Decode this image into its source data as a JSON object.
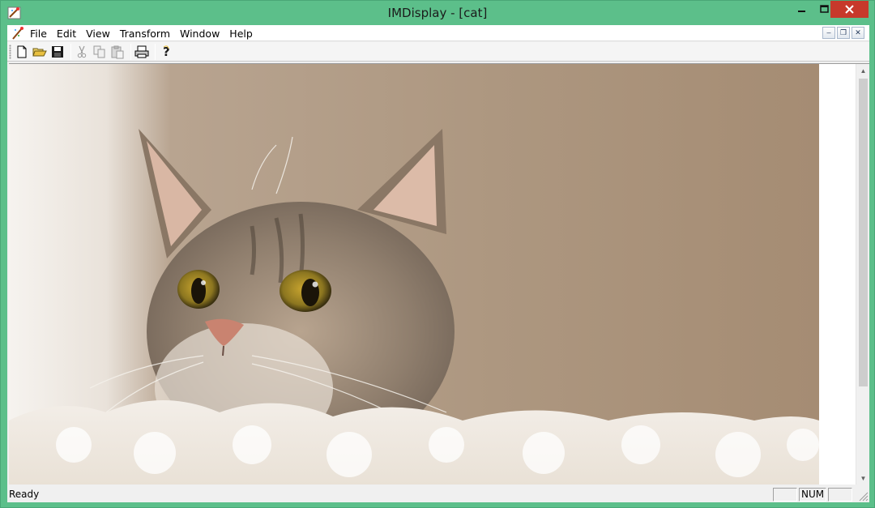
{
  "window": {
    "title": "IMDisplay - [cat]"
  },
  "menubar": {
    "items": [
      {
        "label": "File"
      },
      {
        "label": "Edit"
      },
      {
        "label": "View"
      },
      {
        "label": "Transform"
      },
      {
        "label": "Window"
      },
      {
        "label": "Help"
      }
    ]
  },
  "mdi_controls": {
    "minimize": "–",
    "restore": "❐",
    "close": "✕"
  },
  "toolbar": {
    "buttons": [
      {
        "icon": "new-document-icon"
      },
      {
        "icon": "open-folder-icon"
      },
      {
        "icon": "save-icon"
      },
      {
        "icon": "cut-icon"
      },
      {
        "icon": "copy-icon"
      },
      {
        "icon": "paste-icon"
      },
      {
        "icon": "print-icon"
      },
      {
        "icon": "help-icon"
      }
    ]
  },
  "document": {
    "image_subject": "cat",
    "image_alt": "cat"
  },
  "statusbar": {
    "text": "Ready",
    "panes": [
      "",
      "NUM",
      ""
    ]
  },
  "colors": {
    "title_bar": "#5cbf8a",
    "close_button": "#c7392b",
    "background_beige": "#b59f8a"
  }
}
